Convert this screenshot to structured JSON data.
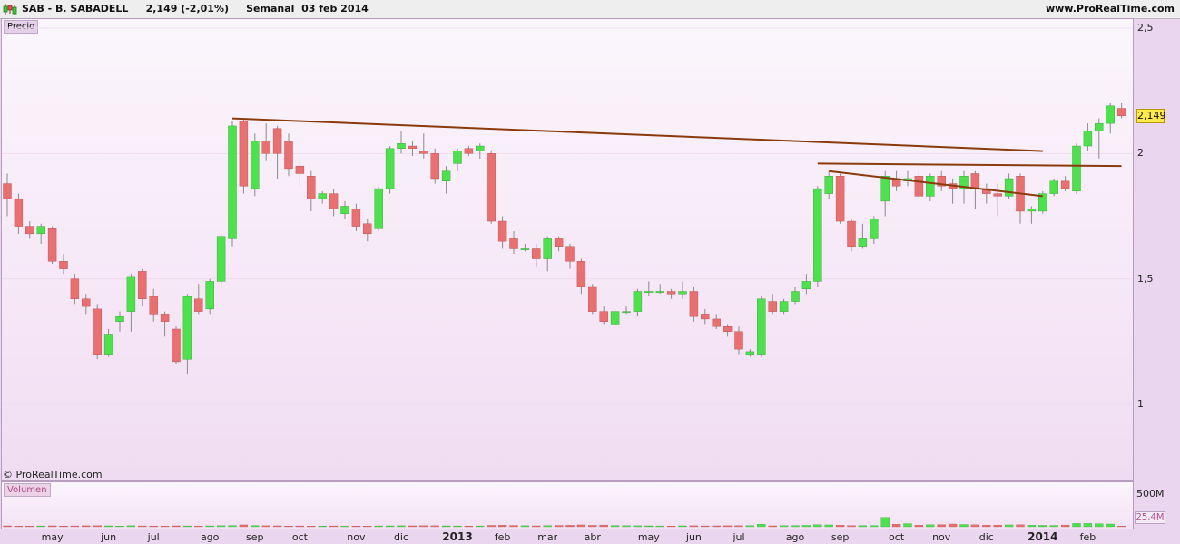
{
  "header": {
    "title": "SAB - B. SABADELL     2,149 (-2,01%)     Semanal  03 feb 2014",
    "source": "www.ProRealTime.com"
  },
  "panels": {
    "price_label": "Precio",
    "volume_label": "Volumen",
    "copyright": "© ProRealTime.com"
  },
  "price_axis": {
    "ticks": [
      {
        "label": "2,5",
        "value": 2.5
      },
      {
        "label": "2",
        "value": 2.0
      },
      {
        "label": "1,5",
        "value": 1.5
      },
      {
        "label": "1",
        "value": 1.0
      }
    ],
    "last_price": "2,149"
  },
  "volume_axis": {
    "max_label": "500M",
    "last_label": "25,4M"
  },
  "colors": {
    "up": "#4de24d",
    "down": "#e87070",
    "trendline": "#8a3a0c",
    "up_border": "#2e9b2e",
    "down_border": "#b04848"
  },
  "chart_data": {
    "type": "candlestick",
    "title": "SAB - B. SABADELL",
    "ylim": [
      0.8,
      2.55
    ],
    "volume_ylim": [
      0,
      560
    ],
    "x_labels": [
      {
        "label": "may",
        "week": 4
      },
      {
        "label": "jun",
        "week": 9
      },
      {
        "label": "jul",
        "week": 13
      },
      {
        "label": "ago",
        "week": 18
      },
      {
        "label": "sep",
        "week": 22
      },
      {
        "label": "oct",
        "week": 26
      },
      {
        "label": "nov",
        "week": 31
      },
      {
        "label": "dic",
        "week": 35
      },
      {
        "label": "2013",
        "week": 40,
        "bold": true
      },
      {
        "label": "feb",
        "week": 44
      },
      {
        "label": "mar",
        "week": 48
      },
      {
        "label": "abr",
        "week": 52
      },
      {
        "label": "may",
        "week": 57
      },
      {
        "label": "jun",
        "week": 61
      },
      {
        "label": "jul",
        "week": 65
      },
      {
        "label": "ago",
        "week": 70
      },
      {
        "label": "sep",
        "week": 74
      },
      {
        "label": "oct",
        "week": 79
      },
      {
        "label": "nov",
        "week": 83
      },
      {
        "label": "dic",
        "week": 87
      },
      {
        "label": "2014",
        "week": 92,
        "bold": true
      },
      {
        "label": "feb",
        "week": 96
      }
    ],
    "candles": [
      [
        1.88,
        1.82,
        1.92,
        1.75,
        12
      ],
      [
        1.82,
        1.71,
        1.84,
        1.68,
        10
      ],
      [
        1.71,
        1.68,
        1.73,
        1.66,
        9
      ],
      [
        1.68,
        1.71,
        1.72,
        1.64,
        11
      ],
      [
        1.7,
        1.57,
        1.71,
        1.56,
        12
      ],
      [
        1.57,
        1.54,
        1.6,
        1.52,
        10
      ],
      [
        1.5,
        1.42,
        1.52,
        1.4,
        11
      ],
      [
        1.42,
        1.39,
        1.44,
        1.36,
        13
      ],
      [
        1.38,
        1.2,
        1.4,
        1.18,
        14
      ],
      [
        1.2,
        1.28,
        1.3,
        1.19,
        12
      ],
      [
        1.33,
        1.35,
        1.37,
        1.29,
        10
      ],
      [
        1.37,
        1.51,
        1.52,
        1.29,
        13
      ],
      [
        1.53,
        1.42,
        1.54,
        1.39,
        11
      ],
      [
        1.43,
        1.36,
        1.46,
        1.33,
        10
      ],
      [
        1.36,
        1.33,
        1.37,
        1.27,
        9
      ],
      [
        1.3,
        1.17,
        1.31,
        1.16,
        12
      ],
      [
        1.18,
        1.43,
        1.44,
        1.12,
        11
      ],
      [
        1.42,
        1.37,
        1.48,
        1.36,
        10
      ],
      [
        1.38,
        1.49,
        1.5,
        1.36,
        12
      ],
      [
        1.49,
        1.67,
        1.68,
        1.47,
        14
      ],
      [
        1.66,
        2.11,
        2.13,
        1.63,
        16
      ],
      [
        2.13,
        1.87,
        2.14,
        1.84,
        24
      ],
      [
        1.86,
        2.05,
        2.08,
        1.83,
        16
      ],
      [
        2.05,
        2.0,
        2.12,
        1.97,
        13
      ],
      [
        2.1,
        2.0,
        2.11,
        1.9,
        12
      ],
      [
        2.05,
        1.94,
        2.08,
        1.91,
        10
      ],
      [
        1.95,
        1.92,
        1.97,
        1.87,
        11
      ],
      [
        1.91,
        1.82,
        1.93,
        1.77,
        9
      ],
      [
        1.82,
        1.84,
        1.85,
        1.8,
        10
      ],
      [
        1.84,
        1.78,
        1.86,
        1.75,
        11
      ],
      [
        1.76,
        1.79,
        1.81,
        1.74,
        9
      ],
      [
        1.78,
        1.71,
        1.8,
        1.69,
        10
      ],
      [
        1.72,
        1.68,
        1.74,
        1.65,
        9
      ],
      [
        1.7,
        1.86,
        1.87,
        1.69,
        11
      ],
      [
        1.86,
        2.02,
        2.03,
        1.84,
        12
      ],
      [
        2.02,
        2.04,
        2.09,
        2.0,
        13
      ],
      [
        2.03,
        2.02,
        2.05,
        1.99,
        12
      ],
      [
        2.01,
        2.0,
        2.08,
        1.98,
        14
      ],
      [
        2.0,
        1.9,
        2.02,
        1.88,
        13
      ],
      [
        1.89,
        1.93,
        1.95,
        1.84,
        12
      ],
      [
        1.96,
        2.01,
        2.02,
        1.93,
        11
      ],
      [
        2.02,
        2.0,
        2.03,
        1.99,
        10
      ],
      [
        2.01,
        2.03,
        2.04,
        1.98,
        11
      ],
      [
        2.0,
        1.73,
        2.01,
        1.72,
        18
      ],
      [
        1.73,
        1.65,
        1.75,
        1.62,
        20
      ],
      [
        1.66,
        1.62,
        1.69,
        1.6,
        17
      ],
      [
        1.62,
        1.62,
        1.64,
        1.61,
        13
      ],
      [
        1.62,
        1.58,
        1.64,
        1.55,
        12
      ],
      [
        1.58,
        1.66,
        1.67,
        1.53,
        15
      ],
      [
        1.66,
        1.63,
        1.67,
        1.61,
        17
      ],
      [
        1.63,
        1.57,
        1.64,
        1.54,
        19
      ],
      [
        1.57,
        1.47,
        1.58,
        1.44,
        24
      ],
      [
        1.47,
        1.37,
        1.48,
        1.36,
        18
      ],
      [
        1.37,
        1.33,
        1.39,
        1.32,
        22
      ],
      [
        1.32,
        1.37,
        1.38,
        1.31,
        16
      ],
      [
        1.37,
        1.37,
        1.39,
        1.36,
        14
      ],
      [
        1.37,
        1.45,
        1.46,
        1.35,
        13
      ],
      [
        1.45,
        1.45,
        1.49,
        1.43,
        12
      ],
      [
        1.45,
        1.45,
        1.48,
        1.44,
        11
      ],
      [
        1.45,
        1.44,
        1.46,
        1.42,
        10
      ],
      [
        1.44,
        1.45,
        1.49,
        1.42,
        12
      ],
      [
        1.45,
        1.35,
        1.47,
        1.33,
        13
      ],
      [
        1.36,
        1.34,
        1.38,
        1.32,
        11
      ],
      [
        1.34,
        1.31,
        1.36,
        1.3,
        12
      ],
      [
        1.31,
        1.29,
        1.32,
        1.27,
        13
      ],
      [
        1.29,
        1.22,
        1.31,
        1.2,
        14
      ],
      [
        1.2,
        1.21,
        1.22,
        1.19,
        15
      ],
      [
        1.2,
        1.42,
        1.43,
        1.19,
        32
      ],
      [
        1.41,
        1.37,
        1.44,
        1.36,
        12
      ],
      [
        1.37,
        1.41,
        1.42,
        1.36,
        14
      ],
      [
        1.41,
        1.45,
        1.47,
        1.4,
        16
      ],
      [
        1.46,
        1.49,
        1.52,
        1.44,
        18
      ],
      [
        1.49,
        1.86,
        1.87,
        1.47,
        26
      ],
      [
        1.84,
        1.91,
        1.93,
        1.82,
        24
      ],
      [
        1.91,
        1.73,
        1.92,
        1.72,
        20
      ],
      [
        1.73,
        1.63,
        1.74,
        1.61,
        14
      ],
      [
        1.63,
        1.66,
        1.72,
        1.62,
        15
      ],
      [
        1.66,
        1.74,
        1.75,
        1.64,
        16
      ],
      [
        1.81,
        1.91,
        1.93,
        1.75,
        120
      ],
      [
        1.9,
        1.87,
        1.93,
        1.85,
        33
      ],
      [
        1.89,
        1.9,
        1.93,
        1.87,
        40
      ],
      [
        1.91,
        1.83,
        1.93,
        1.82,
        20
      ],
      [
        1.83,
        1.91,
        1.92,
        1.81,
        26
      ],
      [
        1.91,
        1.87,
        1.93,
        1.85,
        28
      ],
      [
        1.88,
        1.86,
        1.9,
        1.8,
        35
      ],
      [
        1.86,
        1.91,
        1.93,
        1.8,
        29
      ],
      [
        1.92,
        1.86,
        1.93,
        1.78,
        25
      ],
      [
        1.86,
        1.84,
        1.88,
        1.8,
        20
      ],
      [
        1.84,
        1.83,
        1.88,
        1.75,
        22
      ],
      [
        1.83,
        1.9,
        1.92,
        1.82,
        24
      ],
      [
        1.91,
        1.77,
        1.92,
        1.72,
        26
      ],
      [
        1.77,
        1.78,
        1.79,
        1.72,
        20
      ],
      [
        1.77,
        1.84,
        1.85,
        1.76,
        18
      ],
      [
        1.84,
        1.89,
        1.9,
        1.83,
        17
      ],
      [
        1.89,
        1.86,
        1.91,
        1.85,
        22
      ],
      [
        1.85,
        2.03,
        2.04,
        1.84,
        42
      ],
      [
        2.03,
        2.09,
        2.12,
        2.01,
        42
      ],
      [
        2.09,
        2.12,
        2.14,
        1.98,
        38
      ],
      [
        2.12,
        2.19,
        2.2,
        2.08,
        35
      ],
      [
        2.18,
        2.15,
        2.2,
        2.14,
        10
      ]
    ],
    "trendlines": [
      {
        "from": [
          20,
          2.14
        ],
        "to": [
          92,
          2.01
        ]
      },
      {
        "from": [
          72,
          1.96
        ],
        "to": [
          99,
          1.95
        ]
      },
      {
        "from": [
          73,
          1.93
        ],
        "to": [
          92,
          1.83
        ]
      }
    ]
  }
}
